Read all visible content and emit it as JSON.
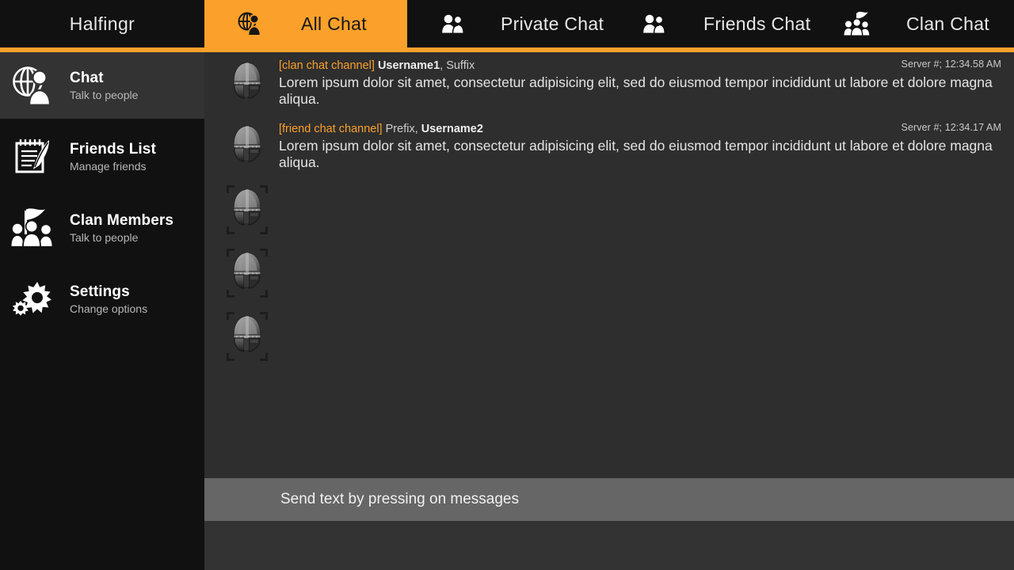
{
  "header": {
    "brand": "Halfingr",
    "tabs": [
      {
        "id": "all",
        "label": "All Chat",
        "icon": "globe-person-icon",
        "active": true
      },
      {
        "id": "private",
        "label": "Private Chat",
        "icon": "two-people-icon",
        "active": false
      },
      {
        "id": "friends",
        "label": "Friends Chat",
        "icon": "two-people-icon",
        "active": false
      },
      {
        "id": "clan",
        "label": "Clan Chat",
        "icon": "clan-banner-icon",
        "active": false
      }
    ],
    "accent_color": "#fba12b",
    "bar_color": "#111111"
  },
  "sidebar": {
    "items": [
      {
        "id": "chat",
        "title": "Chat",
        "subtitle": "Talk to people",
        "icon": "globe-person-icon",
        "selected": true
      },
      {
        "id": "friends",
        "title": "Friends List",
        "subtitle": "Manage friends",
        "icon": "notepad-quill-icon",
        "selected": false
      },
      {
        "id": "clan",
        "title": "Clan Members",
        "subtitle": "Talk to people",
        "icon": "clan-banner-icon",
        "selected": false
      },
      {
        "id": "settings",
        "title": "Settings",
        "subtitle": "Change options",
        "icon": "gears-icon",
        "selected": false
      }
    ],
    "selected_bg": "#333333"
  },
  "messages": [
    {
      "channel": "[clan chat channel]",
      "prefix": "",
      "username": "Username1",
      "suffix": ", Suffix",
      "timestamp": "Server #; 12:34.58 AM",
      "text": "Lorem ipsum dolor sit amet, consectetur adipisicing elit, sed do eiusmod tempor incididunt ut labore et dolore magna aliqua.",
      "avatar": "helmet-avatar-icon",
      "empty": false
    },
    {
      "channel": "[friend chat channel]",
      "prefix": " Prefix,",
      "username": "Username2",
      "suffix": "",
      "timestamp": "Server #; 12:34.17 AM",
      "text": "Lorem ipsum dolor sit amet, consectetur adipisicing elit, sed do eiusmod tempor incididunt ut labore et dolore magna aliqua.",
      "avatar": "helmet-avatar-icon",
      "empty": false
    },
    {
      "channel": "",
      "prefix": "",
      "username": "",
      "suffix": "",
      "timestamp": "",
      "text": "",
      "avatar": "helmet-avatar-icon",
      "empty": true
    },
    {
      "channel": "",
      "prefix": "",
      "username": "",
      "suffix": "",
      "timestamp": "",
      "text": "",
      "avatar": "helmet-avatar-icon",
      "empty": true
    },
    {
      "channel": "",
      "prefix": "",
      "username": "",
      "suffix": "",
      "timestamp": "",
      "text": "",
      "avatar": "helmet-avatar-icon",
      "empty": true
    }
  ],
  "input_bar": {
    "placeholder": "Send text by pressing on messages"
  }
}
